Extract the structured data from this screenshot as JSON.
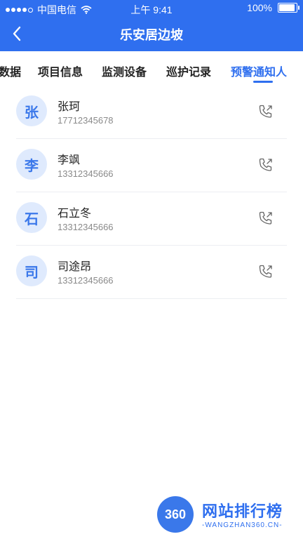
{
  "status_bar": {
    "carrier": "中国电信",
    "time": "上午 9:41",
    "battery": "100%",
    "battery_level": 1.0
  },
  "navbar": {
    "back_icon": "chevron-left-icon",
    "title": "乐安居边坡"
  },
  "tabs": [
    {
      "label": "数据"
    },
    {
      "label": "项目信息"
    },
    {
      "label": "监测设备"
    },
    {
      "label": "巡护记录"
    },
    {
      "label": "预警通知人",
      "active": true
    }
  ],
  "contacts": [
    {
      "avatar": "张",
      "name": "张珂",
      "phone": "17712345678"
    },
    {
      "avatar": "李",
      "name": "李飒",
      "phone": "13312345666"
    },
    {
      "avatar": "石",
      "name": "石立冬",
      "phone": "13312345666"
    },
    {
      "avatar": "司",
      "name": "司途昂",
      "phone": "13312345666"
    }
  ],
  "watermark": {
    "logo": "360",
    "name": "网站排行榜",
    "url": "-WANGZHAN360.CN-"
  },
  "colors": {
    "primary": "#2f6fef",
    "avatar_bg": "#dfeafd",
    "divider": "#eceef2"
  }
}
